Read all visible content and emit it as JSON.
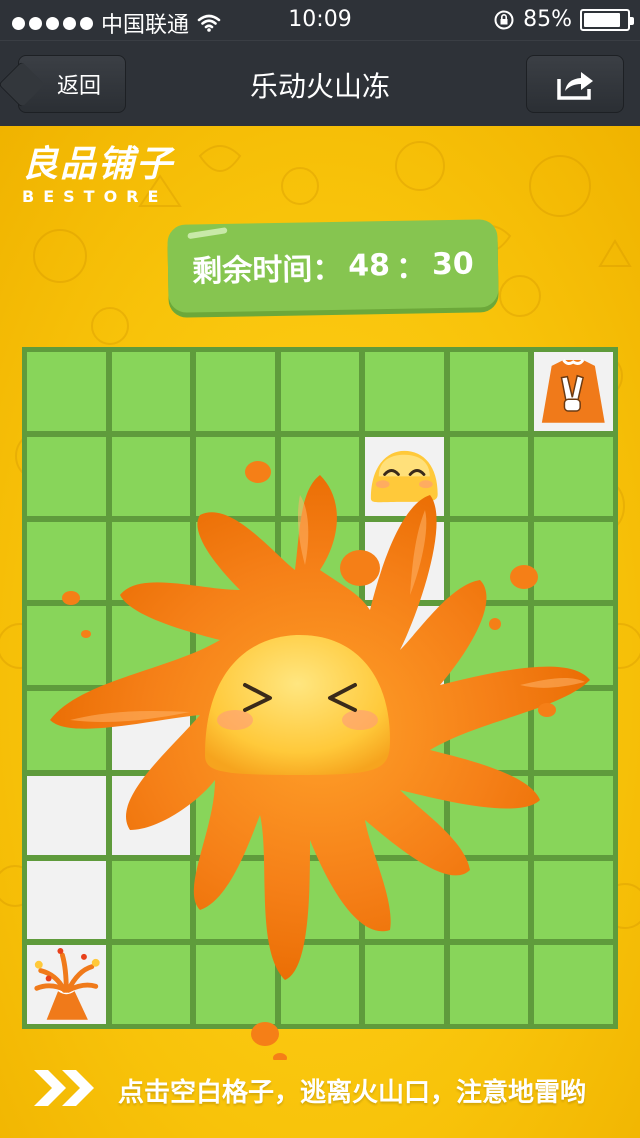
{
  "status_bar": {
    "carrier": "中国联通",
    "time": "10:09",
    "battery_percent": "85%",
    "battery_level": 0.85
  },
  "nav": {
    "back_label": "返回",
    "title": "乐动火山冻"
  },
  "logo": {
    "main": "良品铺子",
    "sub": "BESTORE"
  },
  "timer": {
    "label": "剩余时间：",
    "minutes": "48",
    "separator": "：",
    "seconds": "30"
  },
  "board": {
    "columns": 7,
    "rows": 8,
    "cells": [
      [
        "green",
        "green",
        "green",
        "green",
        "green",
        "green",
        "goal"
      ],
      [
        "green",
        "green",
        "green",
        "green",
        "blob",
        "green",
        "green"
      ],
      [
        "green",
        "green",
        "green",
        "green",
        "white",
        "green",
        "green"
      ],
      [
        "green",
        "green",
        "green",
        "green",
        "white",
        "green",
        "green"
      ],
      [
        "green",
        "white",
        "green",
        "green",
        "green",
        "green",
        "green"
      ],
      [
        "white",
        "white",
        "green",
        "green",
        "green",
        "green",
        "green"
      ],
      [
        "white",
        "green",
        "green",
        "green",
        "green",
        "green",
        "green"
      ],
      [
        "volcano",
        "green",
        "green",
        "green",
        "green",
        "green",
        "green"
      ]
    ]
  },
  "colors": {
    "green_cell": "#88d55a",
    "grid_line": "#5f9b3c",
    "white_cell": "#f2f2f2",
    "lava": "#f57f17",
    "background": "#f8c20c"
  },
  "footer": {
    "hint": "点击空白格子，逃离火山口，注意地雷哟"
  }
}
